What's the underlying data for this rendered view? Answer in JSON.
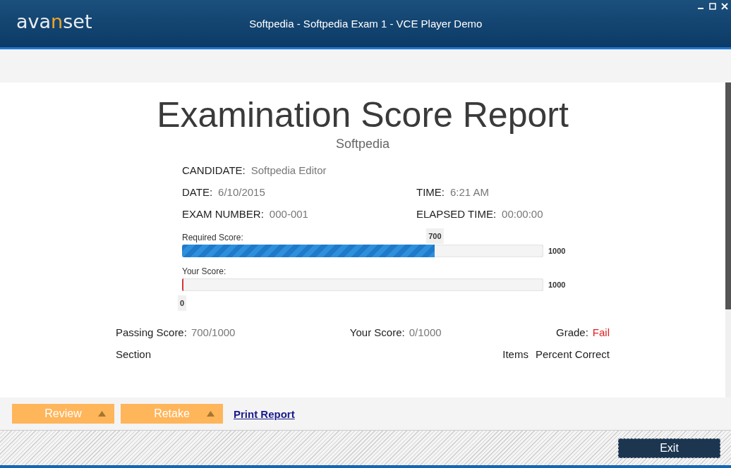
{
  "window": {
    "title": "Softpedia - Softpedia Exam 1 - VCE Player Demo",
    "logo": [
      {
        "text": "ava",
        "accent": false
      },
      {
        "text": "n",
        "accent": true
      },
      {
        "text": "set",
        "accent": false
      }
    ]
  },
  "report": {
    "title": "Examination Score Report",
    "subtitle": "Softpedia",
    "detail_rows": [
      {
        "fields": [
          {
            "label": "CANDIDATE:",
            "value": "Softpedia Editor"
          }
        ]
      },
      {
        "fields": [
          {
            "label": "DATE:",
            "value": "6/10/2015"
          },
          {
            "label": "TIME:",
            "value": "6:21 AM"
          }
        ]
      },
      {
        "fields": [
          {
            "label": "EXAM NUMBER:",
            "value": "000-001"
          },
          {
            "label": "ELAPSED TIME:",
            "value": "00:00:00"
          }
        ]
      }
    ],
    "bars": [
      {
        "label": "Required Score:",
        "level": 0.7,
        "marker": "700",
        "max": "1000",
        "kind": "required"
      },
      {
        "label": "Your Score:",
        "level": 0,
        "marker": "0",
        "max": "1000",
        "kind": "yours"
      }
    ],
    "summary": [
      {
        "label": "Passing Score:",
        "value": "700/1000",
        "kind": "plain"
      },
      {
        "label": "Your Score:",
        "value": "0/1000",
        "kind": "plain"
      },
      {
        "label": "Grade:",
        "value": "Fail",
        "kind": "grade"
      }
    ],
    "section_columns": [
      "Section",
      "Items",
      "Percent Correct"
    ]
  },
  "actions": [
    {
      "label": "Review",
      "kind": "dropdown"
    },
    {
      "label": "Retake",
      "kind": "dropdown"
    },
    {
      "label": "Print Report",
      "kind": "link"
    }
  ],
  "footer": {
    "button": "Exit"
  }
}
